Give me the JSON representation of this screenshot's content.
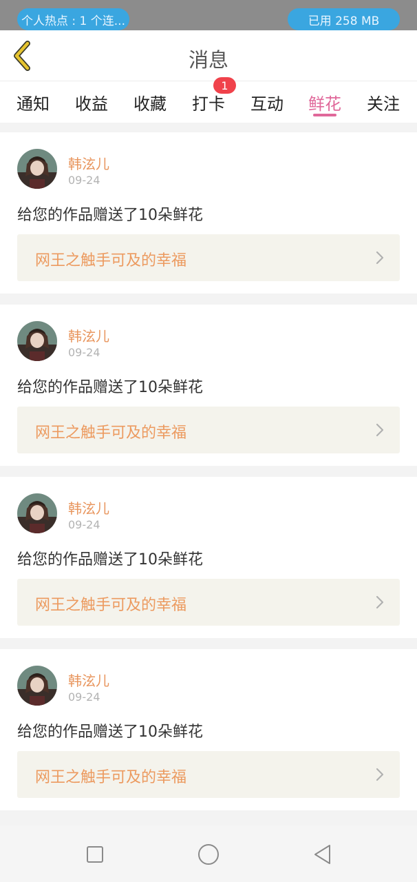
{
  "status_bar": {
    "hotspot_label": "个人热点 : 1 个连...",
    "memory_label": "已用 258 MB"
  },
  "header": {
    "title": "消息",
    "back_icon": "chevron-left-icon",
    "back_color": "#e6c430"
  },
  "tabs": [
    {
      "label": "通知",
      "active": false
    },
    {
      "label": "收益",
      "active": false
    },
    {
      "label": "收藏",
      "active": false
    },
    {
      "label": "打卡",
      "active": false,
      "badge": "1"
    },
    {
      "label": "互动",
      "active": false
    },
    {
      "label": "鲜花",
      "active": true
    },
    {
      "label": "关注",
      "active": false
    }
  ],
  "colors": {
    "accent": "#e0689a",
    "username": "#e8955d",
    "badge": "#f0424b",
    "link_text": "#ec9a5f"
  },
  "messages": [
    {
      "username": "韩泫儿",
      "date": "09-24",
      "text": "给您的作品赠送了10朵鲜花",
      "work_title": "网王之触手可及的幸福"
    },
    {
      "username": "韩泫儿",
      "date": "09-24",
      "text": "给您的作品赠送了10朵鲜花",
      "work_title": "网王之触手可及的幸福"
    },
    {
      "username": "韩泫儿",
      "date": "09-24",
      "text": "给您的作品赠送了10朵鲜花",
      "work_title": "网王之触手可及的幸福"
    },
    {
      "username": "韩泫儿",
      "date": "09-24",
      "text": "给您的作品赠送了10朵鲜花",
      "work_title": "网王之触手可及的幸福"
    }
  ],
  "nav_bar": {
    "icons": [
      "square-recents-icon",
      "circle-home-icon",
      "triangle-back-icon"
    ]
  }
}
